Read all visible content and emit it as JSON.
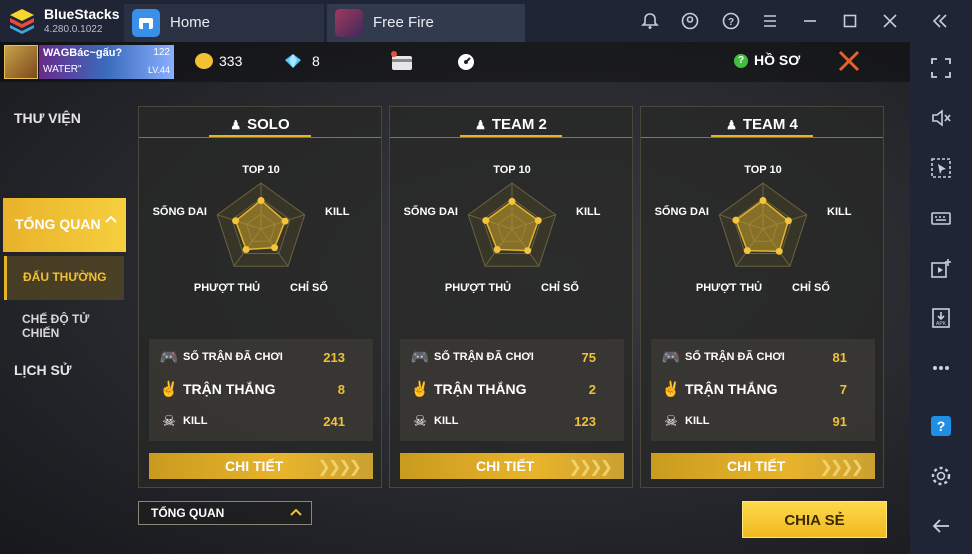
{
  "app": {
    "name": "BlueStacks",
    "version": "4.280.0.1022"
  },
  "tabs": [
    {
      "label": "Home"
    },
    {
      "label": "Free Fire"
    }
  ],
  "window_icons": [
    "bell-icon",
    "account-icon",
    "help-icon",
    "menu-icon",
    "minimize-icon",
    "maximize-icon",
    "close-icon",
    "collapse-icon"
  ],
  "right_sidebar": [
    "fullscreen-icon",
    "volume-mute-icon",
    "select-icon",
    "keyboard-icon",
    "media-icon",
    "apk-icon",
    "more-icon",
    "help-icon",
    "settings-icon",
    "back-icon"
  ],
  "player": {
    "name": "WAGBác~gấu?",
    "name2": "WATER\"",
    "badge": "122",
    "level": "LV.44"
  },
  "currency": {
    "gold": "333",
    "diamonds": "8"
  },
  "profile_label": "HỒ SƠ",
  "nav": {
    "library": "THƯ VIỆN",
    "overview": "TỔNG QUAN",
    "ranked": "ĐẤU THƯỜNG",
    "clash": "CHẾ ĐỘ TỬ CHIẾN",
    "history": "LỊCH SỬ"
  },
  "radar_labels": {
    "top": "TOP 10",
    "left": "SỐNG DAI",
    "right": "KILL",
    "bottom_left": "PHƯỢT THỦ",
    "bottom_right": "CHỈ SỐ"
  },
  "cards": [
    {
      "mode": "SOLO",
      "icon": "solo-icon",
      "stats": [
        {
          "label": "SỐ TRẬN ĐÃ CHƠI",
          "value": "213"
        },
        {
          "label": "TRẬN THẮNG",
          "value": "8"
        },
        {
          "label": "KILL",
          "value": "241"
        }
      ],
      "radar": [
        0.62,
        0.55,
        0.5,
        0.55,
        0.58
      ]
    },
    {
      "mode": "TEAM 2",
      "icon": "duo-icon",
      "stats": [
        {
          "label": "SỐ TRẬN ĐÃ CHƠI",
          "value": "75"
        },
        {
          "label": "TRẬN THẮNG",
          "value": "2"
        },
        {
          "label": "KILL",
          "value": "123"
        }
      ],
      "radar": [
        0.6,
        0.6,
        0.58,
        0.55,
        0.6
      ]
    },
    {
      "mode": "TEAM 4",
      "icon": "squad-icon",
      "stats": [
        {
          "label": "SỐ TRẬN ĐÃ CHƠI",
          "value": "81"
        },
        {
          "label": "TRẬN THẮNG",
          "value": "7"
        },
        {
          "label": "KILL",
          "value": "91"
        }
      ],
      "radar": [
        0.62,
        0.58,
        0.6,
        0.58,
        0.62
      ]
    }
  ],
  "detail_label": "CHI TIẾT",
  "dropdown_value": "TỔNG QUAN",
  "share_label": "CHIA SẺ",
  "colors": {
    "accent": "#f2c035",
    "titlebar": "#1f2534"
  }
}
